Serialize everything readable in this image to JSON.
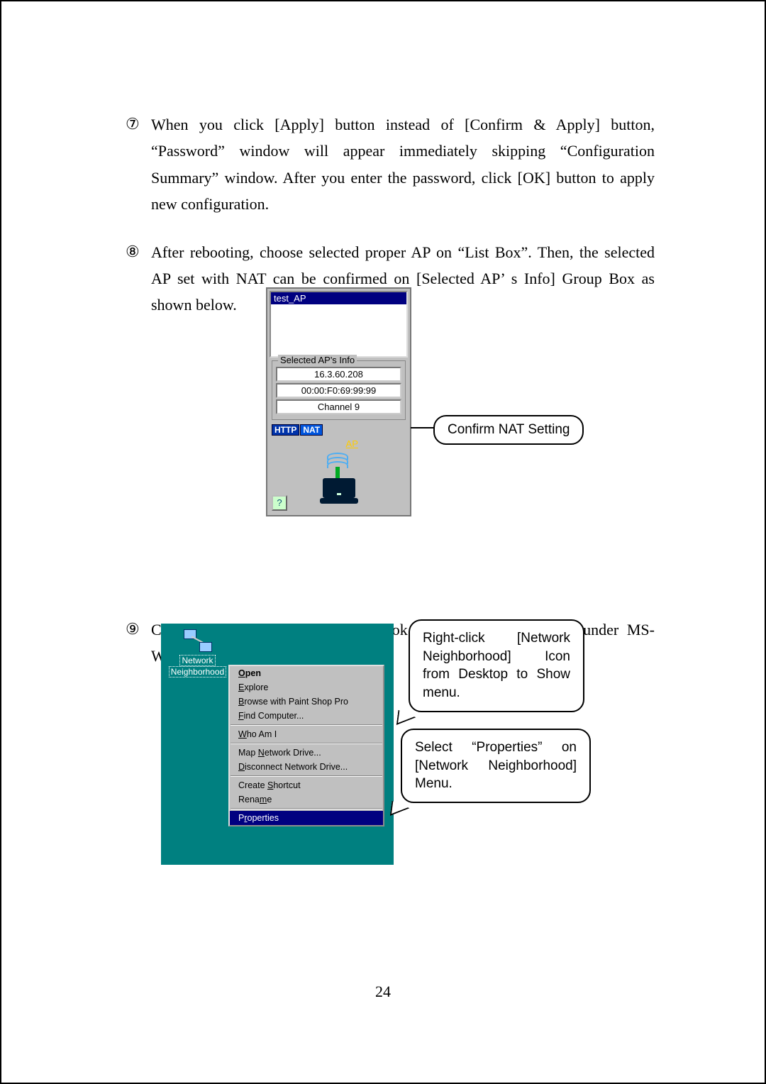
{
  "enum": {
    "i7": "⑦",
    "i8": "⑧",
    "i9": "⑨"
  },
  "para7": "When you click [Apply] button instead of [Confirm & Apply] button, “Password” window will appear immediately skipping “Configuration Summary” window. After you enter the password, click [OK] button to apply new configuration.",
  "para8": "After rebooting, choose selected proper AP on “List Box”. Then, the selected AP set with NAT can be confirmed on [Selected AP’ s Info] Group Box as shown below.",
  "para9": "Configuration of Desktop or notebook PC to connect with AP under MS-Windows is shown below.",
  "fig1": {
    "listbox_item": "test_AP",
    "group_title": "Selected AP's Info",
    "ip": "16.3.60.208",
    "mac": "00:00:F0:69:99:99",
    "channel": "Channel 9",
    "tag_http": "HTTP",
    "tag_nat": "NAT",
    "ap_label": "AP",
    "help": "?"
  },
  "callout1": "Confirm NAT Setting",
  "fig2": {
    "icon_line1": "Network",
    "icon_line2": "Neighborhood",
    "menu": {
      "open": "Open",
      "explore": "Explore",
      "browse": "Browse with Paint Shop Pro",
      "find": "Find Computer...",
      "who": "Who Am I",
      "map": "Map Network Drive...",
      "disc": "Disconnect Network Drive...",
      "shortcut": "Create Shortcut",
      "rename": "Rename",
      "props": "Properties"
    }
  },
  "callout2": "Right-click [Network Neighborhood] Icon from Desktop to Show menu.",
  "callout3": "Select “Properties” on [Network Neighborhood] Menu.",
  "page_number": "24"
}
